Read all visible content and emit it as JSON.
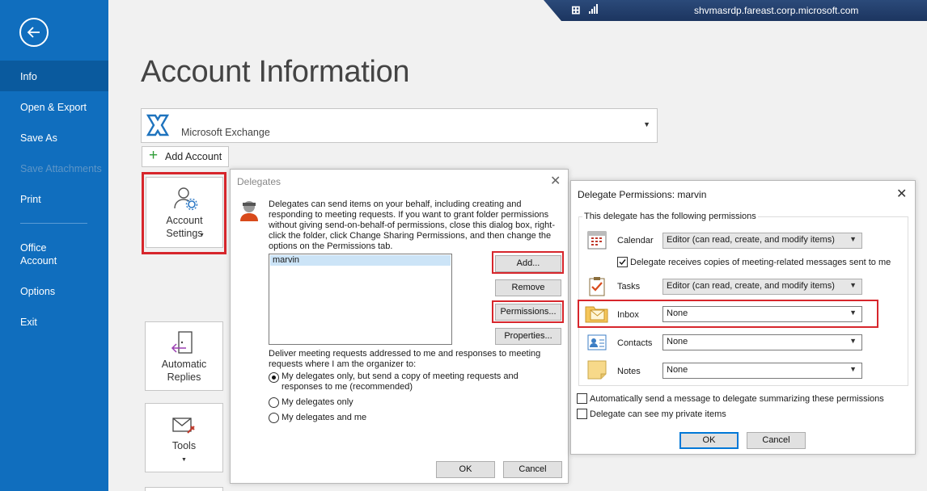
{
  "sidebar": {
    "items": [
      {
        "label": "Info"
      },
      {
        "label": "Open & Export"
      },
      {
        "label": "Save As"
      },
      {
        "label": "Save Attachments"
      },
      {
        "label": "Print"
      },
      {
        "label": "Office\nAccount"
      },
      {
        "label": "Options"
      },
      {
        "label": "Exit"
      }
    ]
  },
  "remote": {
    "host": "shvmasrdp.fareast.corp.microsoft.com"
  },
  "page": {
    "title": "Account Information"
  },
  "account": {
    "type": "Microsoft Exchange",
    "add_label": "Add Account"
  },
  "tiles": {
    "account_settings": "Account\nSettings",
    "automatic_replies": "Automatic\nReplies",
    "tools": "Tools"
  },
  "delegates": {
    "title": "Delegates",
    "description": "Delegates can send items on your behalf, including creating and responding to meeting requests. If you want to grant folder permissions without giving send-on-behalf-of permissions, close this dialog box, right-click the folder, click Change Sharing Permissions, and then change the options on the Permissions tab.",
    "list": [
      "marvin"
    ],
    "buttons": {
      "add": "Add...",
      "remove": "Remove",
      "permissions": "Permissions...",
      "properties": "Properties..."
    },
    "deliver_label": "Deliver meeting requests addressed to me and responses to meeting requests where I am the organizer to:",
    "options": [
      {
        "label": "My delegates only, but send a copy of meeting requests and responses to me (recommended)",
        "selected": true
      },
      {
        "label": "My delegates only",
        "selected": false
      },
      {
        "label": "My delegates and me",
        "selected": false
      }
    ],
    "ok": "OK",
    "cancel": "Cancel"
  },
  "permissions": {
    "title": "Delegate Permissions: marvin",
    "group_label": "This delegate has the following permissions",
    "rows": [
      {
        "icon": "calendar-icon",
        "label": "Calendar",
        "value": "Editor (can read, create, and modify items)"
      },
      {
        "icon": "tasks-icon",
        "label": "Tasks",
        "value": "Editor (can read, create, and modify items)"
      },
      {
        "icon": "inbox-icon",
        "label": "Inbox",
        "value": "None"
      },
      {
        "icon": "contacts-icon",
        "label": "Contacts",
        "value": "None"
      },
      {
        "icon": "notes-icon",
        "label": "Notes",
        "value": "None"
      }
    ],
    "copies_label": "Delegate receives copies of meeting-related messages sent to me",
    "copies_checked": true,
    "auto_message_label": "Automatically send a message to delegate summarizing these permissions",
    "auto_message_checked": false,
    "private_label": "Delegate can see my private items",
    "private_checked": false,
    "ok": "OK",
    "cancel": "Cancel"
  },
  "colors": {
    "sidebar": "#106ebe",
    "highlight": "#d7262c",
    "accent": "#0078d7"
  }
}
